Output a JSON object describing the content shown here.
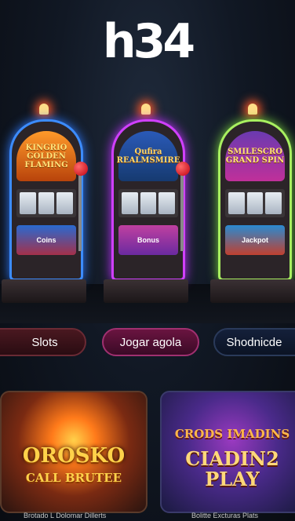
{
  "header": {
    "logo": "h34"
  },
  "machines": [
    {
      "marquee": "KINGRIO GOLDEN FLAMING",
      "panel": "Coins"
    },
    {
      "marquee": "Qufira REALMSMIRE",
      "panel": "Bonus"
    },
    {
      "marquee": "SMILESCRO GRAND SPIN",
      "panel": "Jackpot"
    }
  ],
  "buttons": [
    {
      "label": "Slots"
    },
    {
      "label": "Jogar agola"
    },
    {
      "label": "Shodnicde"
    }
  ],
  "games": [
    {
      "title": "OROSKO",
      "subtitle": "CALL BRUTEE",
      "caption": "Brotado L Dolomar Dillerts"
    },
    {
      "title": "CRODS IMADINS",
      "subtitle": "CIADIN2 PLAY",
      "caption": "Bolitte Excturas Plats"
    }
  ]
}
